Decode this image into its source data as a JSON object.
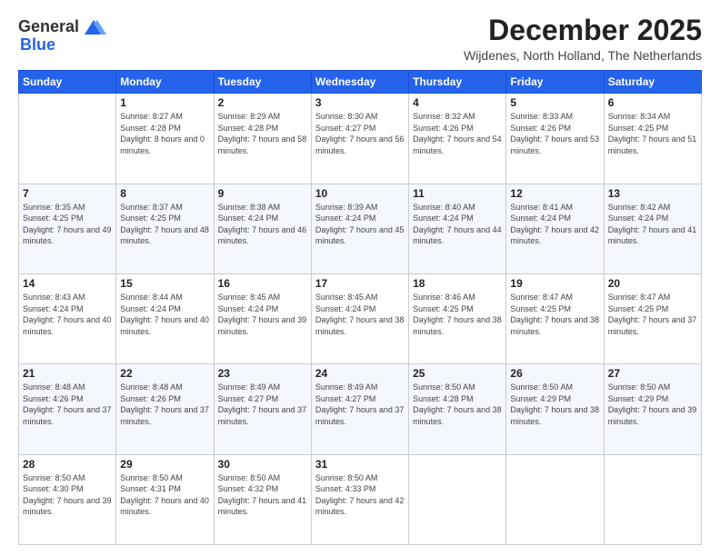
{
  "logo": {
    "general": "General",
    "blue": "Blue"
  },
  "header": {
    "month": "December 2025",
    "location": "Wijdenes, North Holland, The Netherlands"
  },
  "weekdays": [
    "Sunday",
    "Monday",
    "Tuesday",
    "Wednesday",
    "Thursday",
    "Friday",
    "Saturday"
  ],
  "weeks": [
    [
      {
        "day": "",
        "sunrise": "",
        "sunset": "",
        "daylight": ""
      },
      {
        "day": "1",
        "sunrise": "Sunrise: 8:27 AM",
        "sunset": "Sunset: 4:28 PM",
        "daylight": "Daylight: 8 hours and 0 minutes."
      },
      {
        "day": "2",
        "sunrise": "Sunrise: 8:29 AM",
        "sunset": "Sunset: 4:28 PM",
        "daylight": "Daylight: 7 hours and 58 minutes."
      },
      {
        "day": "3",
        "sunrise": "Sunrise: 8:30 AM",
        "sunset": "Sunset: 4:27 PM",
        "daylight": "Daylight: 7 hours and 56 minutes."
      },
      {
        "day": "4",
        "sunrise": "Sunrise: 8:32 AM",
        "sunset": "Sunset: 4:26 PM",
        "daylight": "Daylight: 7 hours and 54 minutes."
      },
      {
        "day": "5",
        "sunrise": "Sunrise: 8:33 AM",
        "sunset": "Sunset: 4:26 PM",
        "daylight": "Daylight: 7 hours and 53 minutes."
      },
      {
        "day": "6",
        "sunrise": "Sunrise: 8:34 AM",
        "sunset": "Sunset: 4:25 PM",
        "daylight": "Daylight: 7 hours and 51 minutes."
      }
    ],
    [
      {
        "day": "7",
        "sunrise": "Sunrise: 8:35 AM",
        "sunset": "Sunset: 4:25 PM",
        "daylight": "Daylight: 7 hours and 49 minutes."
      },
      {
        "day": "8",
        "sunrise": "Sunrise: 8:37 AM",
        "sunset": "Sunset: 4:25 PM",
        "daylight": "Daylight: 7 hours and 48 minutes."
      },
      {
        "day": "9",
        "sunrise": "Sunrise: 8:38 AM",
        "sunset": "Sunset: 4:24 PM",
        "daylight": "Daylight: 7 hours and 46 minutes."
      },
      {
        "day": "10",
        "sunrise": "Sunrise: 8:39 AM",
        "sunset": "Sunset: 4:24 PM",
        "daylight": "Daylight: 7 hours and 45 minutes."
      },
      {
        "day": "11",
        "sunrise": "Sunrise: 8:40 AM",
        "sunset": "Sunset: 4:24 PM",
        "daylight": "Daylight: 7 hours and 44 minutes."
      },
      {
        "day": "12",
        "sunrise": "Sunrise: 8:41 AM",
        "sunset": "Sunset: 4:24 PM",
        "daylight": "Daylight: 7 hours and 42 minutes."
      },
      {
        "day": "13",
        "sunrise": "Sunrise: 8:42 AM",
        "sunset": "Sunset: 4:24 PM",
        "daylight": "Daylight: 7 hours and 41 minutes."
      }
    ],
    [
      {
        "day": "14",
        "sunrise": "Sunrise: 8:43 AM",
        "sunset": "Sunset: 4:24 PM",
        "daylight": "Daylight: 7 hours and 40 minutes."
      },
      {
        "day": "15",
        "sunrise": "Sunrise: 8:44 AM",
        "sunset": "Sunset: 4:24 PM",
        "daylight": "Daylight: 7 hours and 40 minutes."
      },
      {
        "day": "16",
        "sunrise": "Sunrise: 8:45 AM",
        "sunset": "Sunset: 4:24 PM",
        "daylight": "Daylight: 7 hours and 39 minutes."
      },
      {
        "day": "17",
        "sunrise": "Sunrise: 8:45 AM",
        "sunset": "Sunset: 4:24 PM",
        "daylight": "Daylight: 7 hours and 38 minutes."
      },
      {
        "day": "18",
        "sunrise": "Sunrise: 8:46 AM",
        "sunset": "Sunset: 4:25 PM",
        "daylight": "Daylight: 7 hours and 38 minutes."
      },
      {
        "day": "19",
        "sunrise": "Sunrise: 8:47 AM",
        "sunset": "Sunset: 4:25 PM",
        "daylight": "Daylight: 7 hours and 38 minutes."
      },
      {
        "day": "20",
        "sunrise": "Sunrise: 8:47 AM",
        "sunset": "Sunset: 4:25 PM",
        "daylight": "Daylight: 7 hours and 37 minutes."
      }
    ],
    [
      {
        "day": "21",
        "sunrise": "Sunrise: 8:48 AM",
        "sunset": "Sunset: 4:26 PM",
        "daylight": "Daylight: 7 hours and 37 minutes."
      },
      {
        "day": "22",
        "sunrise": "Sunrise: 8:48 AM",
        "sunset": "Sunset: 4:26 PM",
        "daylight": "Daylight: 7 hours and 37 minutes."
      },
      {
        "day": "23",
        "sunrise": "Sunrise: 8:49 AM",
        "sunset": "Sunset: 4:27 PM",
        "daylight": "Daylight: 7 hours and 37 minutes."
      },
      {
        "day": "24",
        "sunrise": "Sunrise: 8:49 AM",
        "sunset": "Sunset: 4:27 PM",
        "daylight": "Daylight: 7 hours and 37 minutes."
      },
      {
        "day": "25",
        "sunrise": "Sunrise: 8:50 AM",
        "sunset": "Sunset: 4:28 PM",
        "daylight": "Daylight: 7 hours and 38 minutes."
      },
      {
        "day": "26",
        "sunrise": "Sunrise: 8:50 AM",
        "sunset": "Sunset: 4:29 PM",
        "daylight": "Daylight: 7 hours and 38 minutes."
      },
      {
        "day": "27",
        "sunrise": "Sunrise: 8:50 AM",
        "sunset": "Sunset: 4:29 PM",
        "daylight": "Daylight: 7 hours and 39 minutes."
      }
    ],
    [
      {
        "day": "28",
        "sunrise": "Sunrise: 8:50 AM",
        "sunset": "Sunset: 4:30 PM",
        "daylight": "Daylight: 7 hours and 39 minutes."
      },
      {
        "day": "29",
        "sunrise": "Sunrise: 8:50 AM",
        "sunset": "Sunset: 4:31 PM",
        "daylight": "Daylight: 7 hours and 40 minutes."
      },
      {
        "day": "30",
        "sunrise": "Sunrise: 8:50 AM",
        "sunset": "Sunset: 4:32 PM",
        "daylight": "Daylight: 7 hours and 41 minutes."
      },
      {
        "day": "31",
        "sunrise": "Sunrise: 8:50 AM",
        "sunset": "Sunset: 4:33 PM",
        "daylight": "Daylight: 7 hours and 42 minutes."
      },
      {
        "day": "",
        "sunrise": "",
        "sunset": "",
        "daylight": ""
      },
      {
        "day": "",
        "sunrise": "",
        "sunset": "",
        "daylight": ""
      },
      {
        "day": "",
        "sunrise": "",
        "sunset": "",
        "daylight": ""
      }
    ]
  ]
}
